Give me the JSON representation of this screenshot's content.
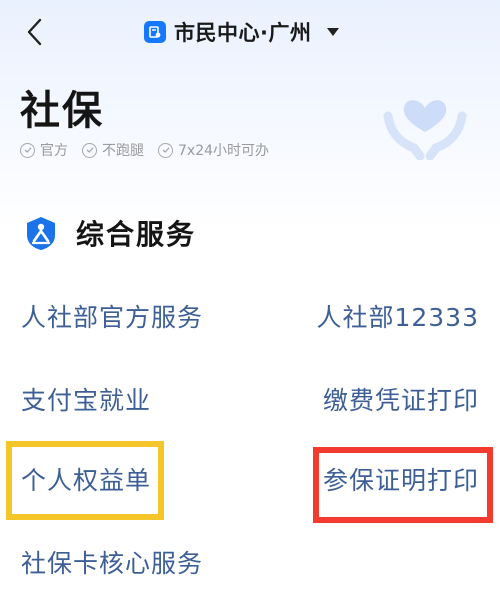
{
  "header": {
    "city": "市民中心·广州"
  },
  "page": {
    "title": "社保",
    "tags": [
      "官方",
      "不跑腿",
      "7x24小时可办"
    ]
  },
  "section": {
    "title": "综合服务"
  },
  "services": {
    "left": [
      "人社部官方服务",
      "支付宝就业",
      "个人权益单",
      "社保卡核心服务"
    ],
    "right": [
      "人社部12333",
      "缴费凭证打印",
      "参保证明打印"
    ]
  },
  "highlights": {
    "yellow_color": "#f5c62a",
    "red_color": "#f23a2f"
  },
  "colors": {
    "accent": "#1677ff",
    "link": "#3d5f96"
  },
  "icons": {
    "back": "chevron-left-icon",
    "city": "id-card-icon",
    "dropdown": "caret-down-icon",
    "tag": "check-circle-icon",
    "hero": "hands-heart-icon",
    "section": "social-security-logo-icon"
  }
}
